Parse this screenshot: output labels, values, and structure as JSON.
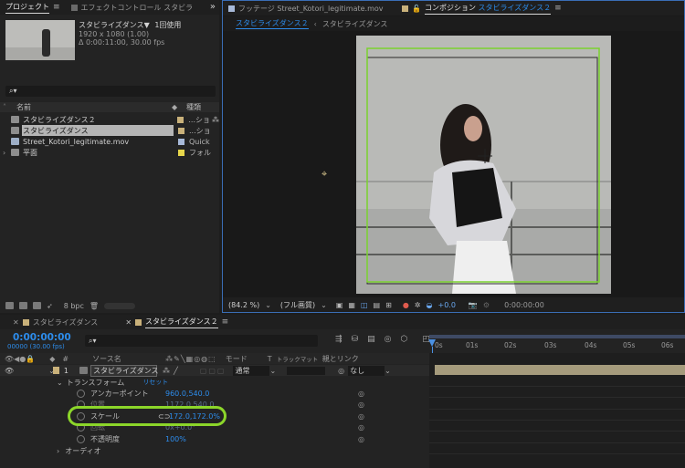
{
  "project": {
    "tabs": [
      {
        "label": "プロジェクト",
        "active": true
      },
      {
        "label": "エフェクトコントロール スタビラ",
        "active": false
      }
    ],
    "more": "»",
    "selected_name": "スタビライズダンス▼",
    "usage": "1回使用",
    "meta_size": "1920 x 1080 (1.00)",
    "meta_duration": "Δ 0:00:11:00, 30.00 fps",
    "search_placeholder": "⌕▾",
    "col_name": "名前",
    "col_type": "種類",
    "items": [
      {
        "name": "スタビライズダンス２",
        "type": "...ショ",
        "selected": false,
        "color": "#c9b17a"
      },
      {
        "name": "スタビライズダンス",
        "type": "...ショ",
        "selected": true,
        "color": "#c9b17a"
      },
      {
        "name": "Street_Kotori_legitimate.mov",
        "type": "Quick",
        "selected": false,
        "color": "#a7b9d8"
      },
      {
        "name": "平面",
        "type": "フォル",
        "selected": false,
        "color": "#e6d64b"
      }
    ],
    "bpc": "8 bpc"
  },
  "viewer": {
    "tabs": [
      {
        "label": "フッテージ Street_Kotori_legitimate.mov",
        "active": false
      },
      {
        "label": "コンポジション",
        "accent": "スタビライズダンス２",
        "active": true
      }
    ],
    "breadcrumb_active": "スタビライズダンス２",
    "breadcrumb_next": "スタビライズダンス",
    "zoom": "(84.2 %)",
    "quality": "(フル画質)",
    "exposure": "+0.0",
    "timecode": "0:00:00:00"
  },
  "timeline": {
    "tabs": [
      {
        "label": "スタビライズダンス",
        "active": false
      },
      {
        "label": "スタビライズダンス２",
        "active": true
      }
    ],
    "current_time": "0:00:00:00",
    "frames": "00000 (30.00 fps)",
    "search_placeholder": "⌕▾",
    "headers": {
      "num": "#",
      "source": "ソース名",
      "mode": "モード",
      "t": "T",
      "trkmat": "トラックマット",
      "parent": "親とリンク"
    },
    "layer": {
      "num": "1",
      "name": "スタビライズダンス",
      "mode": "通常",
      "parent": "なし"
    },
    "transform_label": "トランスフォーム",
    "reset_label": "リセット",
    "properties": [
      {
        "name": "アンカーポイント",
        "value": "960.0,540.0"
      },
      {
        "name": "位置",
        "value": "1172.0,540.0"
      },
      {
        "name": "スケール",
        "value": "172.0,172.0%"
      },
      {
        "name": "回転",
        "value": "0x+0.0°"
      },
      {
        "name": "不透明度",
        "value": "100%"
      }
    ],
    "audio_label": "オーディオ",
    "ruler": [
      "0s",
      "01s",
      "02s",
      "03s",
      "04s",
      "05s",
      "06s"
    ]
  },
  "colors": {
    "accent": "#2d8ceb",
    "highlight_ring": "#8cd62a",
    "comp_border": "#78d12e"
  }
}
